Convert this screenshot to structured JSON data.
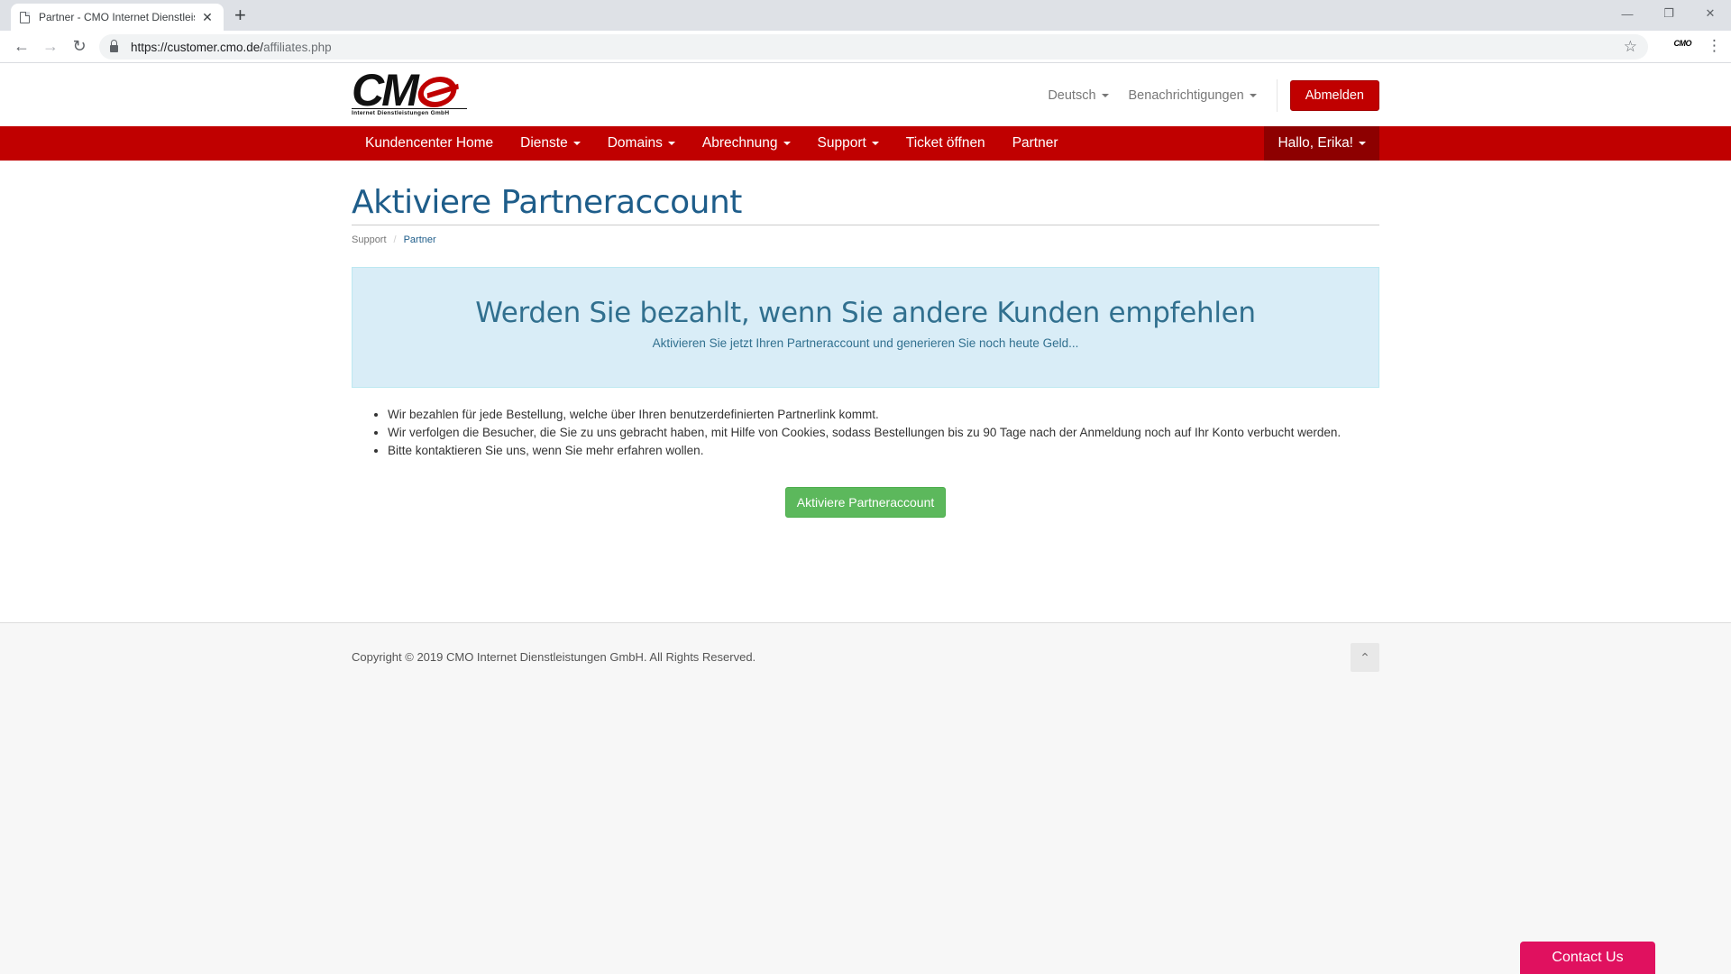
{
  "browser": {
    "tab_title": "Partner - CMO Internet Dienstleistungen GmbH",
    "tab_close": "✕",
    "new_tab": "+",
    "url_host": "https://customer.cmo.de/",
    "url_path": "affiliates.php",
    "ext_label": "CMO"
  },
  "header": {
    "logo_letters": "CM",
    "logo_subtitle": "Internet Dienstleistungen GmbH",
    "language": "Deutsch",
    "notifications": "Benachrichtigungen",
    "logout": "Abmelden"
  },
  "nav": {
    "items": [
      {
        "label": "Kundencenter Home",
        "dropdown": false
      },
      {
        "label": "Dienste",
        "dropdown": true
      },
      {
        "label": "Domains",
        "dropdown": true
      },
      {
        "label": "Abrechnung",
        "dropdown": true
      },
      {
        "label": "Support",
        "dropdown": true
      },
      {
        "label": "Ticket öffnen",
        "dropdown": false
      },
      {
        "label": "Partner",
        "dropdown": false
      }
    ],
    "user": "Hallo, Erika!"
  },
  "page": {
    "title": "Aktiviere Partneraccount",
    "breadcrumb": [
      "Support",
      "Partner"
    ],
    "breadcrumb_sep": "/",
    "jumbo_title": "Werden Sie bezahlt, wenn Sie andere Kunden empfehlen",
    "jumbo_sub": "Aktivieren Sie jetzt Ihren Partneraccount und generieren Sie noch heute Geld...",
    "bullets": [
      "Wir bezahlen für jede Bestellung, welche über Ihren benutzerdefinierten Partnerlink kommt.",
      "Wir verfolgen die Besucher, die Sie zu uns gebracht haben, mit Hilfe von Cookies, sodass Bestellungen bis zu 90 Tage nach der Anmeldung noch auf Ihr Konto verbucht werden.",
      "Bitte kontaktieren Sie uns, wenn Sie mehr erfahren wollen."
    ],
    "cta": "Aktiviere Partneraccount"
  },
  "footer": {
    "copyright": "Copyright © 2019 CMO Internet Dienstleistungen GmbH. All Rights Reserved."
  },
  "widget": {
    "contact": "Contact Us"
  },
  "colors": {
    "brand_red": "#c00000",
    "nav_user_bg": "#8d0000",
    "title_blue": "#1e5d8a",
    "cta_green": "#5cb85c",
    "contact_pink": "#e0115f"
  }
}
